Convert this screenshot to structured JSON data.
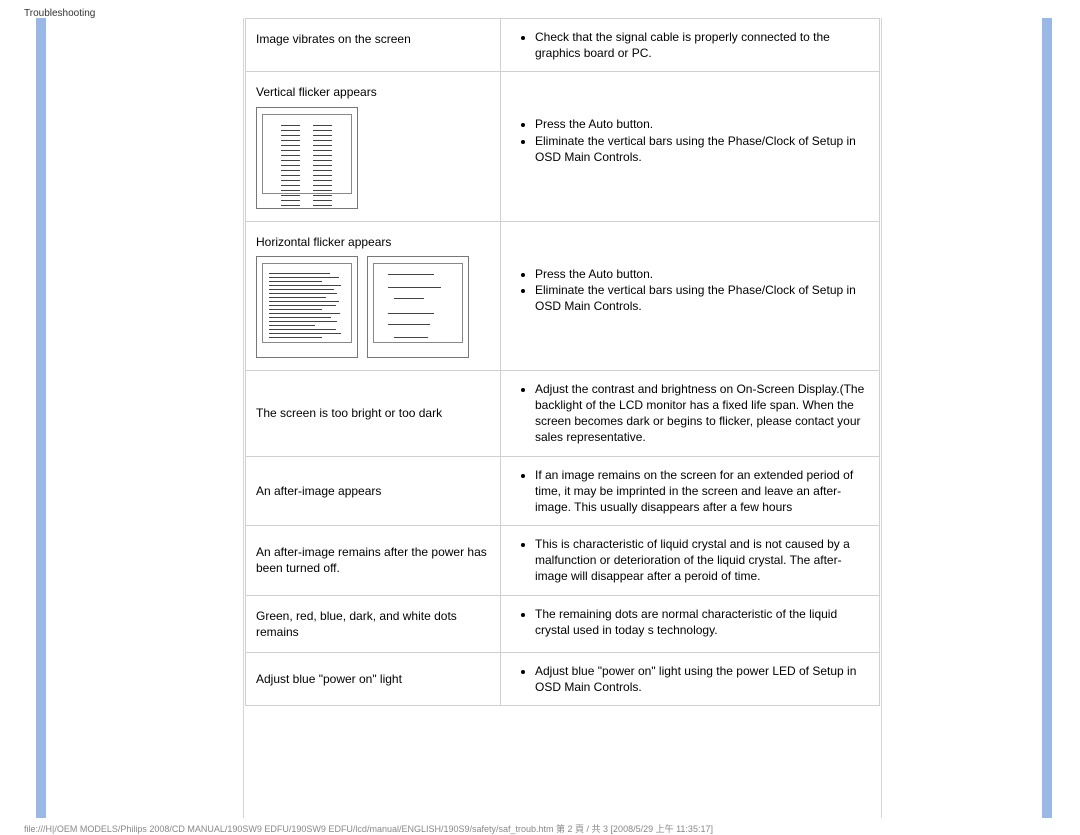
{
  "header": {
    "title": "Troubleshooting"
  },
  "rows": [
    {
      "problem": "Image vibrates on the screen",
      "answers": [
        "Check that the signal cable is properly connected to the graphics board or PC."
      ]
    },
    {
      "problem": "Vertical flicker appears",
      "answers": [
        "Press the Auto button.",
        "Eliminate the vertical bars using the Phase/Clock of Setup in OSD Main Controls."
      ]
    },
    {
      "problem": "Horizontal flicker appears",
      "answers": [
        "Press the Auto button.",
        "Eliminate the vertical bars using the Phase/Clock of Setup in OSD Main Controls."
      ]
    },
    {
      "problem": "The screen is too bright or too dark",
      "answers": [
        "Adjust the contrast and brightness on On-Screen Display.(The backlight of the LCD monitor has a fixed life span. When the screen becomes dark or begins to flicker, please contact your sales representative."
      ]
    },
    {
      "problem": "An after-image appears",
      "answers": [
        "If an image remains on the screen for an extended period of time, it may be imprinted in the screen and leave an after-image. This usually disappears after a few hours"
      ]
    },
    {
      "problem": "An after-image remains after the power has been turned off.",
      "answers": [
        "This is characteristic of liquid crystal and is not caused by a malfunction or deterioration of the liquid crystal. The after-image will disappear after a peroid of time."
      ]
    },
    {
      "problem": "Green, red, blue, dark, and white dots remains",
      "answers": [
        "The remaining dots are normal characteristic of the liquid crystal used in today s technology."
      ]
    },
    {
      "problem": "Adjust blue \"power on\" light",
      "answers": [
        "Adjust blue \"power on\" light using the power LED of Setup in OSD Main Controls."
      ]
    }
  ],
  "footer": "file:///H|/OEM MODELS/Philips 2008/CD MANUAL/190SW9 EDFU/190SW9 EDFU/lcd/manual/ENGLISH/190S9/safety/saf_troub.htm 第 2 頁 / 共 3  [2008/5/29 上午 11:35:17]"
}
